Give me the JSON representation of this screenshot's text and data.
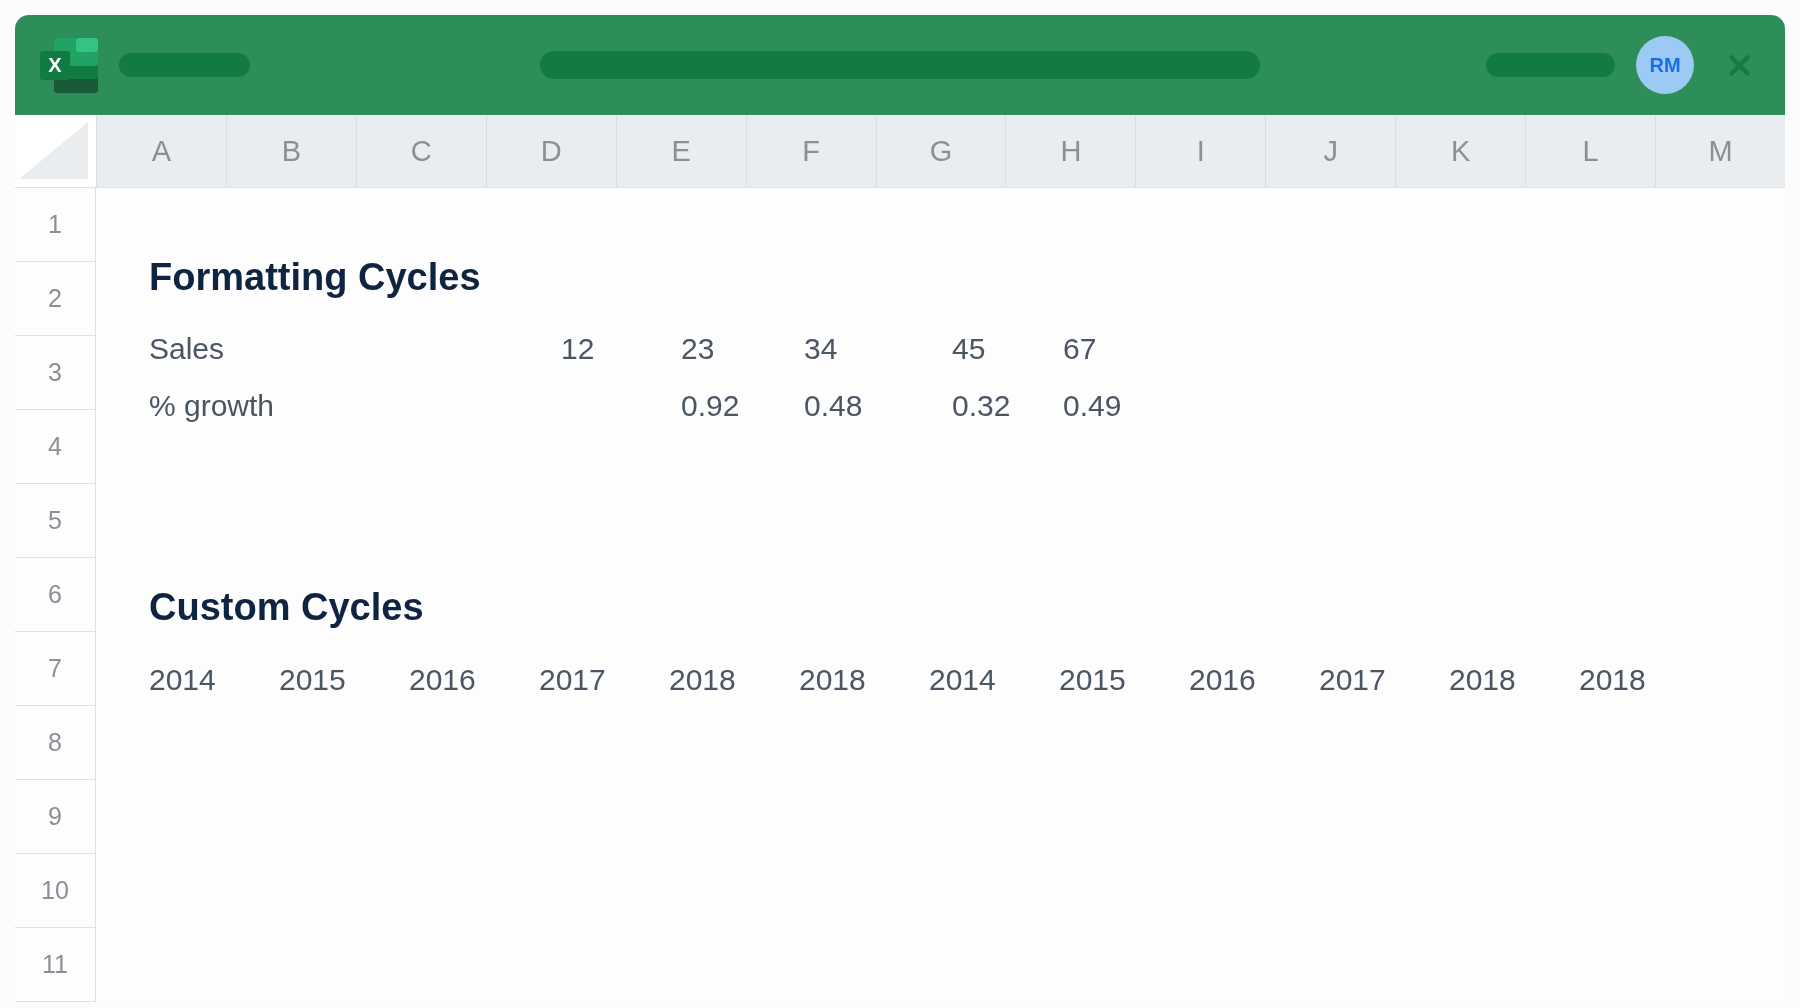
{
  "title_bar": {
    "logo": {
      "letter": "X"
    },
    "avatar": {
      "initials": "RM"
    }
  },
  "column_headers": [
    "A",
    "B",
    "C",
    "D",
    "E",
    "F",
    "G",
    "H",
    "I",
    "J",
    "K",
    "L",
    "M"
  ],
  "row_headers": [
    "1",
    "2",
    "3",
    "4",
    "5",
    "6",
    "7",
    "8",
    "9",
    "10",
    "11"
  ],
  "sheet": {
    "sections": [
      {
        "kind": "table",
        "title": "Formatting Cycles",
        "rows": [
          {
            "label": "Sales",
            "values": [
              "12",
              "23",
              "34",
              "45",
              "67"
            ]
          },
          {
            "label": "% growth",
            "values": [
              "0.92",
              "0.48",
              "0.32",
              "0.49"
            ]
          }
        ]
      },
      {
        "kind": "series",
        "title": "Custom Cycles",
        "values": [
          "2014",
          "2015",
          "2016",
          "2017",
          "2018",
          "2018",
          "2014",
          "2015",
          "2016",
          "2017",
          "2018",
          "2018"
        ]
      }
    ]
  }
}
